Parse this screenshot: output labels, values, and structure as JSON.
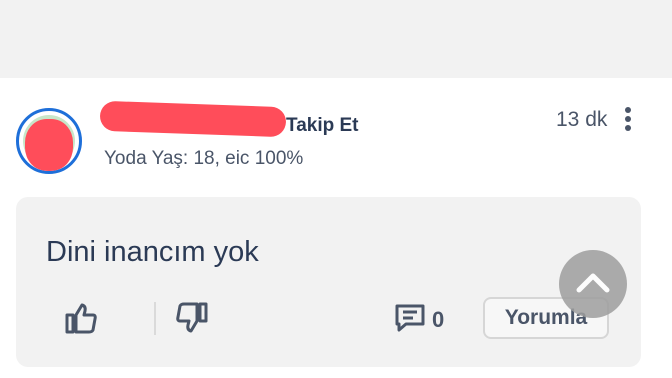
{
  "post": {
    "follow_label": "Takip Et",
    "meta": "Yoda Yaş: 18, eic 100%",
    "time": "13 dk",
    "comment": "Dini inancım yok",
    "replies_count": "0",
    "reply_button": "Yorumla"
  },
  "icons": {
    "more": "more-vert-icon",
    "like": "thumbs-up-icon",
    "dislike": "thumbs-down-icon",
    "reply": "comment-icon",
    "scroll_top": "chevron-up-icon"
  },
  "colors": {
    "accent_blue": "#1e6fd9",
    "redaction": "#ff4d5a",
    "text_primary": "#2b3a55",
    "text_secondary": "#4a5568",
    "card_bg": "#f2f2f2"
  }
}
